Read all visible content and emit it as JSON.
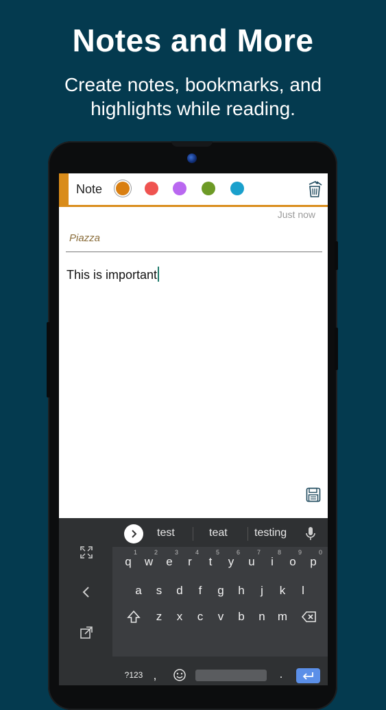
{
  "promo": {
    "headline": "Notes and More",
    "subline_1": "Create notes, bookmarks, and",
    "subline_2": "highlights while reading."
  },
  "note_editor": {
    "toolbar_label": "Note",
    "colors": [
      "#d97f11",
      "#ef5350",
      "#b968f0",
      "#6d9a26",
      "#1aa0cc"
    ],
    "selected_color_index": 0,
    "accent_color": "#d98c1a",
    "timestamp": "Just now",
    "title_value": "Piazza",
    "body_text": "This is important"
  },
  "keyboard": {
    "suggestions": [
      "test",
      "teat",
      "testing"
    ],
    "row1": [
      "q",
      "w",
      "e",
      "r",
      "t",
      "y",
      "u",
      "i",
      "o",
      "p"
    ],
    "row1_hints": [
      "1",
      "2",
      "3",
      "4",
      "5",
      "6",
      "7",
      "8",
      "9",
      "0"
    ],
    "row2": [
      "a",
      "s",
      "d",
      "f",
      "g",
      "h",
      "j",
      "k",
      "l"
    ],
    "row3": [
      "z",
      "x",
      "c",
      "v",
      "b",
      "n",
      "m"
    ],
    "symbols_label": "?123",
    "comma": ",",
    "period": "."
  }
}
